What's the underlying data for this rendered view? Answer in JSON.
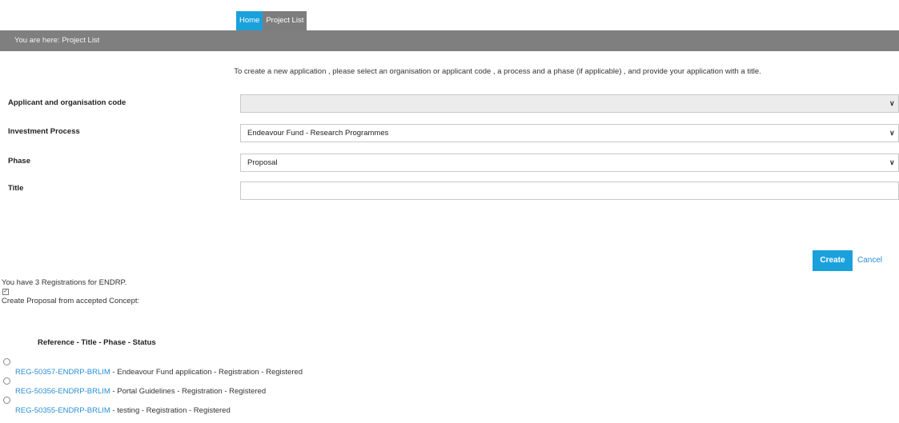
{
  "tabs": [
    {
      "label": "Home"
    },
    {
      "label": "Project List"
    }
  ],
  "breadcrumb": "You are here: Project List",
  "intro": "To create a new application , please select an organisation or applicant code , a process and a phase (if applicable) , and provide your application with a title.",
  "form": {
    "applicant": {
      "label": "Applicant and organisation code",
      "value": ""
    },
    "process": {
      "label": "Investment Process",
      "value": "Endeavour Fund - Research Programmes"
    },
    "phase": {
      "label": "Phase",
      "value": "Proposal"
    },
    "title": {
      "label": "Title",
      "value": ""
    }
  },
  "actions": {
    "create": "Create",
    "cancel": "Cancel"
  },
  "registrations": {
    "count_text": "You have 3 Registrations for ENDRP.",
    "checkbox_checked": true,
    "concept_label": "Create Proposal from accepted Concept:",
    "list_header": "Reference - Title - Phase - Status",
    "items": [
      {
        "ref": "REG-50357-ENDRP-BRLIM",
        "rest": " - Endeavour Fund application - Registration - Registered"
      },
      {
        "ref": "REG-50356-ENDRP-BRLIM",
        "rest": " - Portal Guidelines - Registration - Registered"
      },
      {
        "ref": "REG-50355-ENDRP-BRLIM",
        "rest": " - testing - Registration - Registered"
      }
    ]
  },
  "colors": {
    "accent": "#1aa1dc",
    "link": "#2a8ed6",
    "breadcrumb_bg": "#7f7f7f"
  }
}
